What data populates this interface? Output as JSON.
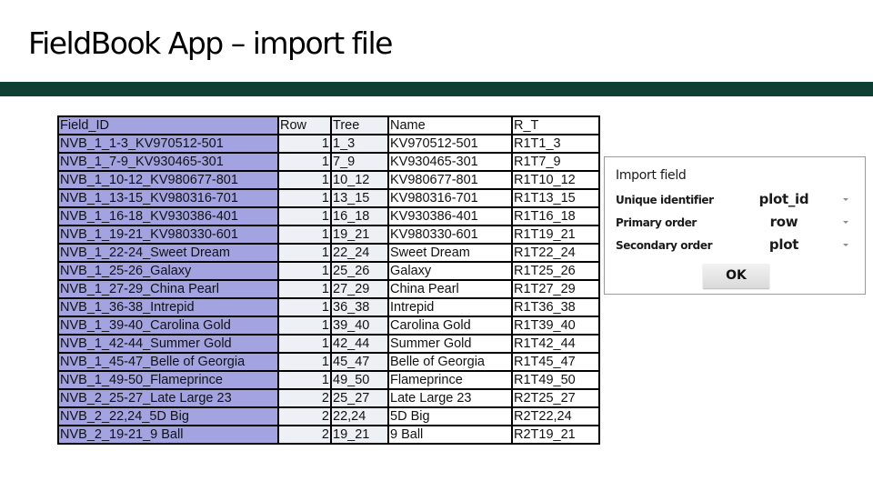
{
  "slide": {
    "title": "FieldBook App – import file",
    "accent_bar_color": "#0f3f33"
  },
  "spreadsheet": {
    "headers": [
      "Field_ID",
      "Row",
      "Tree",
      "Name",
      "R_T"
    ],
    "rows": [
      [
        "NVB_1_1-3_KV970512-501",
        "1",
        "1_3",
        "KV970512-501",
        "R1T1_3"
      ],
      [
        "NVB_1_7-9_KV930465-301",
        "1",
        "7_9",
        "KV930465-301",
        "R1T7_9"
      ],
      [
        "NVB_1_10-12_KV980677-801",
        "1",
        "10_12",
        "KV980677-801",
        "R1T10_12"
      ],
      [
        "NVB_1_13-15_KV980316-701",
        "1",
        "13_15",
        "KV980316-701",
        "R1T13_15"
      ],
      [
        "NVB_1_16-18_KV930386-401",
        "1",
        "16_18",
        "KV930386-401",
        "R1T16_18"
      ],
      [
        "NVB_1_19-21_KV980330-601",
        "1",
        "19_21",
        "KV980330-601",
        "R1T19_21"
      ],
      [
        "NVB_1_22-24_Sweet Dream",
        "1",
        "22_24",
        "Sweet Dream",
        "R1T22_24"
      ],
      [
        "NVB_1_25-26_Galaxy",
        "1",
        "25_26",
        "Galaxy",
        "R1T25_26"
      ],
      [
        "NVB_1_27-29_China Pearl",
        "1",
        "27_29",
        "China Pearl",
        "R1T27_29"
      ],
      [
        "NVB_1_36-38_Intrepid",
        "1",
        "36_38",
        "Intrepid",
        "R1T36_38"
      ],
      [
        "NVB_1_39-40_Carolina Gold",
        "1",
        "39_40",
        "Carolina Gold",
        "R1T39_40"
      ],
      [
        "NVB_1_42-44_Summer Gold",
        "1",
        "42_44",
        "Summer Gold",
        "R1T42_44"
      ],
      [
        "NVB_1_45-47_Belle of Georgia",
        "1",
        "45_47",
        "Belle of Georgia",
        "R1T45_47"
      ],
      [
        "NVB_1_49-50_Flameprince",
        "1",
        "49_50",
        "Flameprince",
        "R1T49_50"
      ],
      [
        "NVB_2_25-27_Late Large 23",
        "2",
        "25_27",
        "Late Large 23",
        "R2T25_27"
      ],
      [
        "NVB_2_22,24_5D Big",
        "2",
        "22,24",
        "5D Big",
        "R2T22,24"
      ],
      [
        "NVB_2_19-21_9 Ball",
        "2",
        "19_21",
        "9 Ball",
        "R2T19_21"
      ]
    ],
    "colors": {
      "field_id_fill": "#a3a3e1",
      "row_tree_fill": "#edf1f5",
      "border": "#000000"
    }
  },
  "import_dialog": {
    "title": "Import field",
    "fields": [
      {
        "label": "Unique identifier",
        "value": "plot_id",
        "icon": "dropdown-arrow-icon"
      },
      {
        "label": "Primary order",
        "value": "row",
        "icon": "dropdown-arrow-icon"
      },
      {
        "label": "Secondary order",
        "value": "plot",
        "icon": "dropdown-arrow-icon"
      }
    ],
    "ok_label": "OK"
  }
}
